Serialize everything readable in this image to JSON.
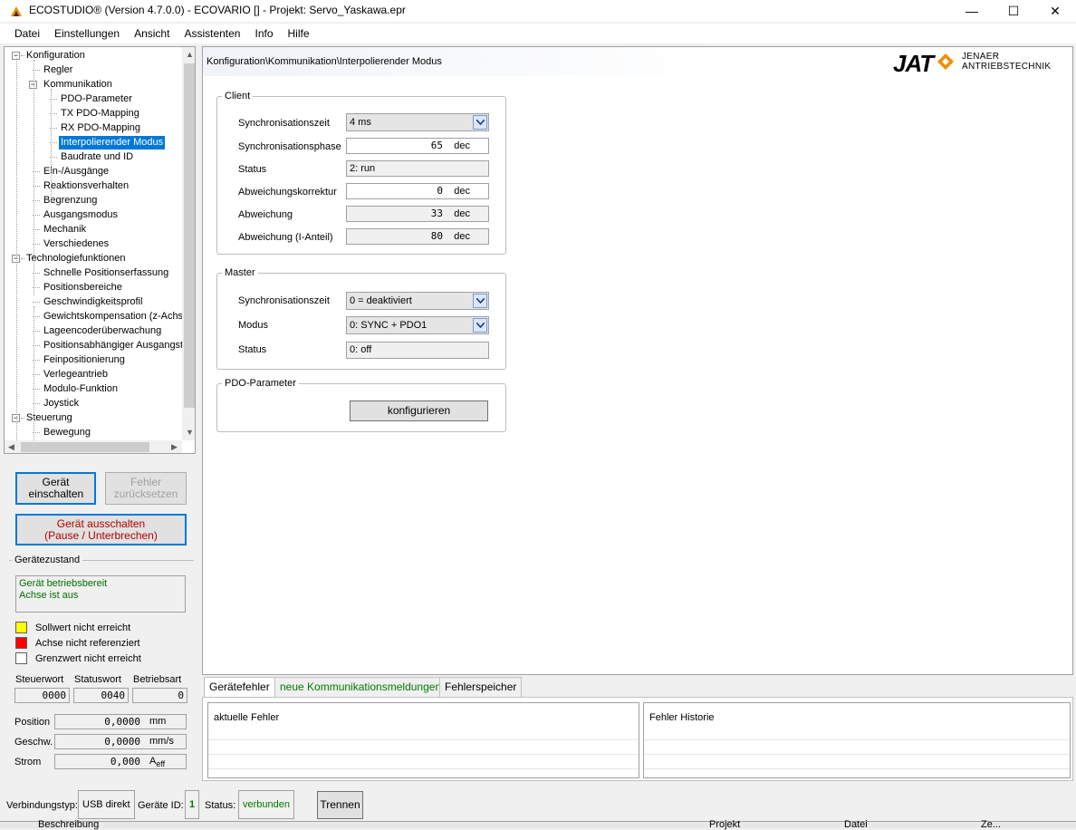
{
  "window": {
    "title": "ECOSTUDIO® (Version 4.7.0.0) - ECOVARIO [] - Projekt: Servo_Yaskawa.epr",
    "minimize": "—",
    "maximize": "☐",
    "close": "✕"
  },
  "menu": [
    "Datei",
    "Einstellungen",
    "Ansicht",
    "Assistenten",
    "Info",
    "Hilfe"
  ],
  "tree": {
    "items": [
      {
        "label": "Konfiguration",
        "level": 0,
        "expanded": true
      },
      {
        "label": "Regler",
        "level": 1
      },
      {
        "label": "Kommunikation",
        "level": 1,
        "expanded": true
      },
      {
        "label": "PDO-Parameter",
        "level": 2
      },
      {
        "label": "TX PDO-Mapping",
        "level": 2
      },
      {
        "label": "RX PDO-Mapping",
        "level": 2
      },
      {
        "label": "Interpolierender Modus",
        "level": 2,
        "selected": true
      },
      {
        "label": "Baudrate und ID",
        "level": 2
      },
      {
        "label": "Ein-/Ausgänge",
        "level": 1
      },
      {
        "label": "Reaktionsverhalten",
        "level": 1
      },
      {
        "label": "Begrenzung",
        "level": 1
      },
      {
        "label": "Ausgangsmodus",
        "level": 1
      },
      {
        "label": "Mechanik",
        "level": 1
      },
      {
        "label": "Verschiedenes",
        "level": 1
      },
      {
        "label": "Technologiefunktionen",
        "level": 0,
        "expanded": true
      },
      {
        "label": "Schnelle Positionserfassung",
        "level": 1
      },
      {
        "label": "Positionsbereiche",
        "level": 1
      },
      {
        "label": "Geschwindigkeitsprofil",
        "level": 1
      },
      {
        "label": "Gewichtskompensation (z-Achse",
        "level": 1
      },
      {
        "label": "Lageencoderüberwachung",
        "level": 1
      },
      {
        "label": "Positionsabhängiger Ausgangstri",
        "level": 1
      },
      {
        "label": "Feinpositionierung",
        "level": 1
      },
      {
        "label": "Verlegeantrieb",
        "level": 1
      },
      {
        "label": "Modulo-Funktion",
        "level": 1
      },
      {
        "label": "Joystick",
        "level": 1
      },
      {
        "label": "Steuerung",
        "level": 0,
        "expanded": true
      },
      {
        "label": "Bewegung",
        "level": 1
      }
    ]
  },
  "controls": {
    "power_on": "Gerät einschalten",
    "reset_error": "Fehler zurücksetzen",
    "power_off_line1": "Gerät ausschalten",
    "power_off_line2": "(Pause / Unterbrechen)",
    "device_state_label": "Gerätezustand",
    "device_state_lines": [
      "Gerät betriebsbereit",
      "Achse ist aus"
    ],
    "legend": [
      {
        "label": "Sollwert nicht erreicht",
        "color": "#ffff00"
      },
      {
        "label": "Achse nicht referenziert",
        "color": "#ff0000"
      },
      {
        "label": "Grenzwert nicht erreicht",
        "color": "#ffffff"
      }
    ],
    "steuerwort_label": "Steuerwort",
    "statuswort_label": "Statuswort",
    "betriebsart_label": "Betriebsart",
    "steuerwort": "0000",
    "statuswort": "0040",
    "betriebsart": "0",
    "position_label": "Position",
    "position_value": "0,0000",
    "position_unit": "mm",
    "speed_label": "Geschw.",
    "speed_value": "0,0000",
    "speed_unit": "mm/s",
    "current_label": "Strom",
    "current_value": "0,000",
    "current_unit": "A",
    "current_unit_sub": "eff"
  },
  "main": {
    "breadcrumb": "Konfiguration\\Kommunikation\\Interpolierender Modus",
    "logo_jat": "JAT",
    "logo_line1": "JENAER",
    "logo_line2": "ANTRIEBSTECHNIK",
    "client": {
      "title": "Client",
      "sync_time_label": "Synchronisationszeit",
      "sync_time_value": "4 ms",
      "sync_phase_label": "Synchronisationsphase",
      "sync_phase_value": "65",
      "sync_phase_unit": "dec",
      "status_label": "Status",
      "status_value": "2: run",
      "dev_correction_label": "Abweichungskorrektur",
      "dev_correction_value": "0",
      "dev_correction_unit": "dec",
      "deviation_label": "Abweichung",
      "deviation_value": "33",
      "deviation_unit": "dec",
      "deviation_i_label": "Abweichung (I-Anteil)",
      "deviation_i_value": "80",
      "deviation_i_unit": "dec"
    },
    "master": {
      "title": "Master",
      "sync_time_label": "Synchronisationszeit",
      "sync_time_value": "0 = deaktiviert",
      "mode_label": "Modus",
      "mode_value": "0: SYNC + PDO1",
      "status_label": "Status",
      "status_value": "0: off"
    },
    "pdo": {
      "title": "PDO-Parameter",
      "configure_button": "konfigurieren"
    }
  },
  "bottom": {
    "tabs": [
      "Gerätefehler",
      "neue Kommunikationsmeldungen",
      "Fehlerspeicher"
    ],
    "current_errors": "aktuelle Fehler",
    "error_history": "Fehler Historie"
  },
  "statusbar": {
    "connection_type_label": "Verbindungstyp:",
    "connection_type_value": "USB direkt",
    "device_id_label": "Geräte ID:",
    "device_id_value": "1",
    "status_label": "Status:",
    "status_value": "verbunden",
    "disconnect_button": "Trennen"
  },
  "underlay": {
    "col1": "Beschreibung",
    "col2": "Projekt",
    "col3": "Datei",
    "col4": "Ze..."
  },
  "colors": {
    "selection": "#0078d7",
    "status_green": "#007a00",
    "danger_red": "#b00000"
  }
}
